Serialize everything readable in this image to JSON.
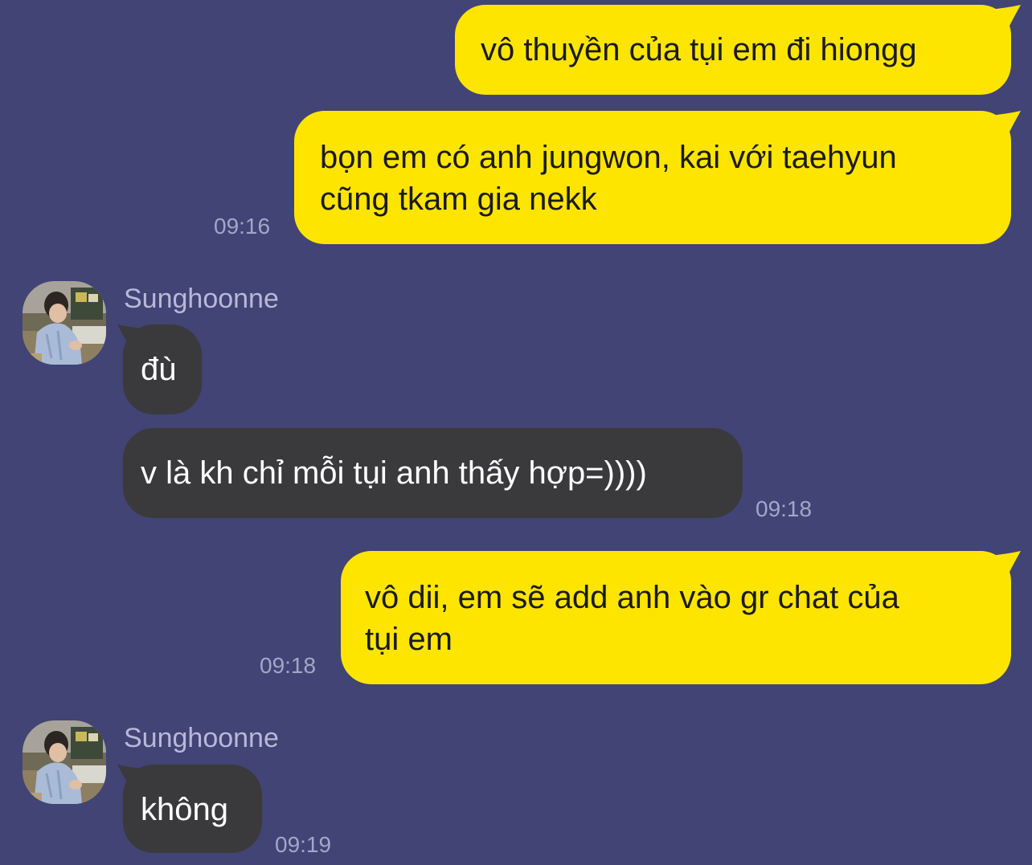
{
  "colors": {
    "background": "#414475",
    "outgoing_bubble": "#fee500",
    "incoming_bubble": "#3a3a3c",
    "timestamp": "#a3a6c9",
    "sender_name": "#b7b9d9"
  },
  "messages": [
    {
      "direction": "outgoing",
      "lines": [
        "vô thuyền của tụi em đi hiongg"
      ],
      "time": ""
    },
    {
      "direction": "outgoing",
      "lines": [
        "bọn em có anh jungwon, kai với taehyun",
        "cũng tkam gia nekk"
      ],
      "time": "09:16"
    },
    {
      "direction": "incoming",
      "sender": "Sunghoonne",
      "avatar": "profile-photo",
      "lines": [
        "đù"
      ],
      "time": ""
    },
    {
      "direction": "incoming",
      "lines": [
        "v là kh chỉ mỗi tụi anh thấy hợp=))))"
      ],
      "time": "09:18"
    },
    {
      "direction": "outgoing",
      "lines": [
        "vô dii, em sẽ add anh vào gr chat của",
        "tụi em"
      ],
      "time": "09:18"
    },
    {
      "direction": "incoming",
      "sender": "Sunghoonne",
      "avatar": "profile-photo",
      "lines": [
        "không"
      ],
      "time": "09:19"
    }
  ]
}
